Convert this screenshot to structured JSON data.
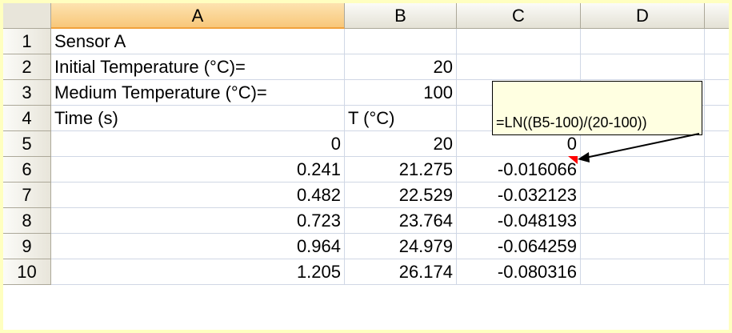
{
  "columns": [
    "A",
    "B",
    "C",
    "D"
  ],
  "rows": [
    {
      "num": "1",
      "cells": [
        "Sensor A",
        "",
        "",
        ""
      ]
    },
    {
      "num": "2",
      "cells": [
        "Initial Temperature (°C)=",
        "20",
        "",
        ""
      ]
    },
    {
      "num": "3",
      "cells": [
        "Medium Temperature (°C)=",
        "100",
        "",
        ""
      ]
    },
    {
      "num": "4",
      "cells": [
        "Time (s)",
        "T (°C)",
        "",
        ""
      ]
    },
    {
      "num": "5",
      "cells": [
        "0",
        "20",
        "0",
        ""
      ]
    },
    {
      "num": "6",
      "cells": [
        "0.241",
        "21.275",
        "-0.016066",
        ""
      ]
    },
    {
      "num": "7",
      "cells": [
        "0.482",
        "22.529",
        "-0.032123",
        ""
      ]
    },
    {
      "num": "8",
      "cells": [
        "0.723",
        "23.764",
        "-0.048193",
        ""
      ]
    },
    {
      "num": "9",
      "cells": [
        "0.964",
        "24.979",
        "-0.064259",
        ""
      ]
    },
    {
      "num": "10",
      "cells": [
        "1.205",
        "26.174",
        "-0.080316",
        ""
      ]
    }
  ],
  "comment": {
    "text": "=LN((B5-100)/(20-100))"
  },
  "colors": {
    "background": "#ffffc0",
    "grid": "#d0d7e5",
    "header": "#e4e1d5",
    "selected_header": "#f8c77a",
    "comment_indicator": "#ff0000"
  },
  "selected_column": "A"
}
